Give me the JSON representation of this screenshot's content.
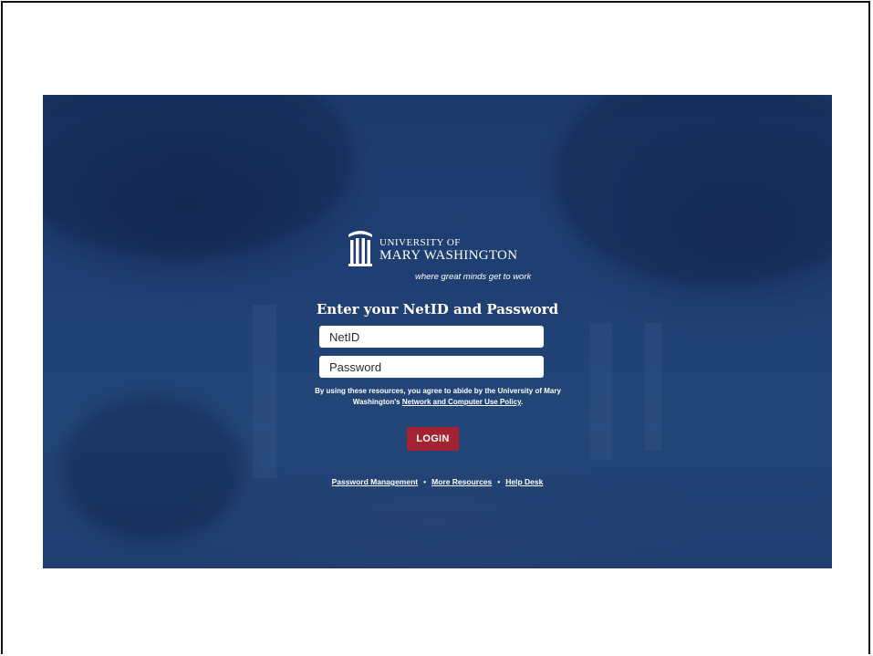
{
  "logo": {
    "line1": "UNIVERSITY OF",
    "line2": "MARY WASHINGTON",
    "tagline": "where great minds get to work",
    "icon": "columns-icon"
  },
  "login": {
    "heading": "Enter your NetID and Password",
    "netid_placeholder": "NetID",
    "password_placeholder": "Password",
    "notice_prefix": "By using these resources, you agree to abide by the University of Mary Washington's ",
    "notice_link": "Network and Computer Use Policy",
    "notice_suffix": ".",
    "button_label": "LOGIN"
  },
  "footer": {
    "links": [
      "Password Management",
      "More Resources",
      "Help Desk"
    ],
    "separator": "•"
  },
  "colors": {
    "background": "#1f3f73",
    "button": "#a42333",
    "text": "#ffffff"
  }
}
